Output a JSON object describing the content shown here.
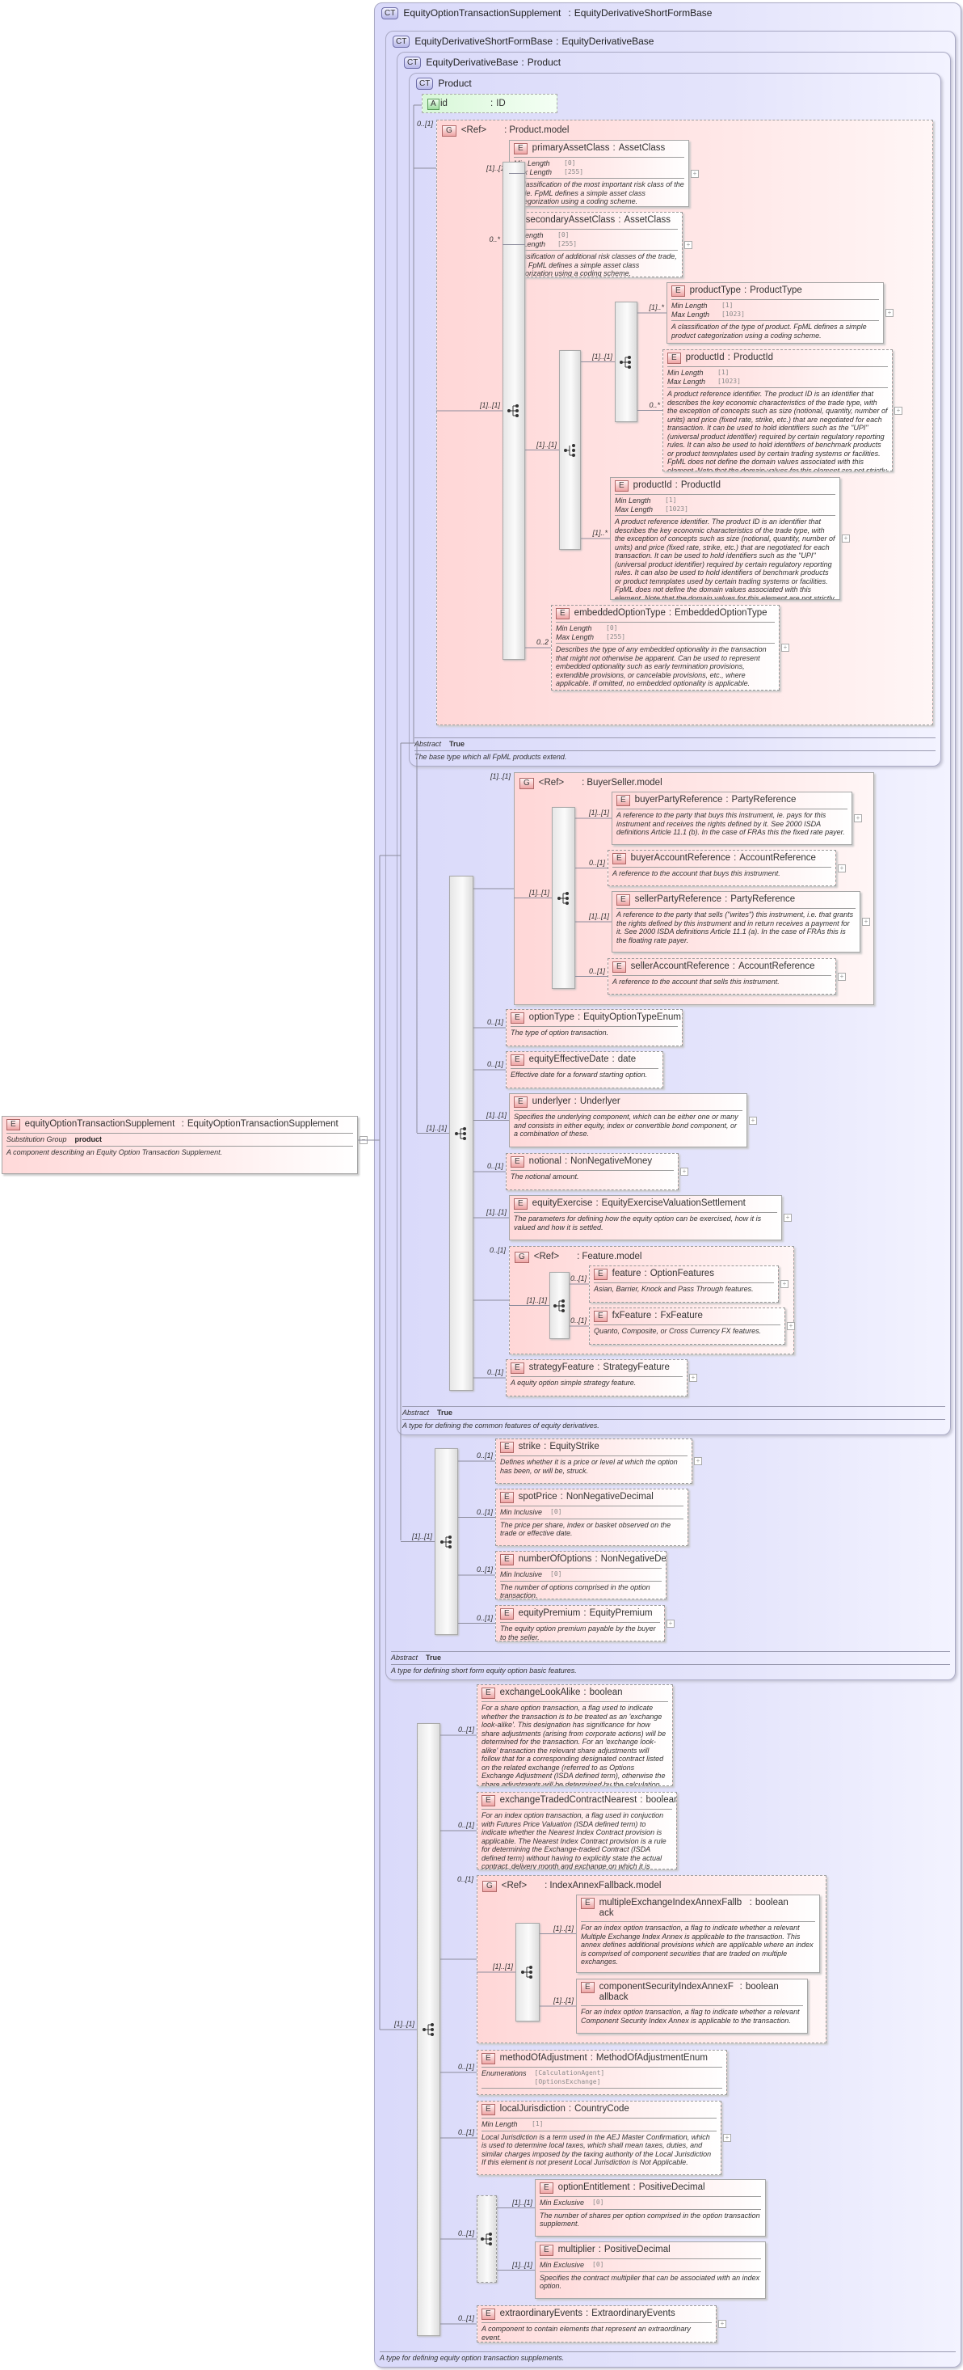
{
  "root": {
    "badge": "E",
    "name": "equityOptionTransactionSupplement",
    "type": "EquityOptionTransactionSupplement",
    "substitution_label": "Substitution Group",
    "substitution_value": "product",
    "doc": "A component describing an Equity Option Transaction Supplement.",
    "expand_icon": "−"
  },
  "complex_types": {
    "ct0": {
      "badge": "CT",
      "name": "EquityOptionTransactionSupplement",
      "base": "EquityDerivativeShortFormBase",
      "doc": "A type for defining equity option transaction supplements."
    },
    "ct1": {
      "badge": "CT",
      "name": "EquityDerivativeShortFormBase",
      "base": "EquityDerivativeBase",
      "abstract_label": "Abstract",
      "abstract_value": "True",
      "doc": "A type for defining short form equity option basic features."
    },
    "ct2": {
      "badge": "CT",
      "name": "EquityDerivativeBase",
      "base": "Product",
      "abstract_label": "Abstract",
      "abstract_value": "True",
      "doc": "A type for defining the common features of equity derivatives."
    },
    "ct3": {
      "badge": "CT",
      "name": "Product",
      "abstract_label": "Abstract",
      "abstract_value": "True",
      "doc": "The base type which all FpML products extend."
    }
  },
  "attribute": {
    "badge": "A",
    "name": "id",
    "type": "ID"
  },
  "groups": {
    "g1": {
      "badge": "G",
      "ref": "<Ref>",
      "name": "Product.model",
      "cardinality": "0..[1]"
    },
    "g2": {
      "badge": "G",
      "ref": "<Ref>",
      "name": "BuyerSeller.model",
      "cardinality": "[1]..[1]"
    },
    "g3": {
      "badge": "G",
      "ref": "<Ref>",
      "name": "Feature.model",
      "cardinality": "0..[1]"
    },
    "g4": {
      "badge": "G",
      "ref": "<Ref>",
      "name": "IndexAnnexFallback.model",
      "cardinality": "0..[1]"
    }
  },
  "compositors": {
    "A": {
      "kind": "sequence",
      "cardinality": "[1]..[1]"
    },
    "B": {
      "kind": "choice",
      "cardinality": "[1]..[1]"
    },
    "C": {
      "kind": "sequence",
      "cardinality": "[1]..[1]"
    },
    "D": {
      "kind": "sequence",
      "cardinality": "[1]..[1]"
    },
    "E": {
      "kind": "sequence",
      "cardinality": "[1]..[1]"
    },
    "F": {
      "kind": "sequence",
      "cardinality": "[1]..[1]"
    },
    "G": {
      "kind": "sequence",
      "cardinality": "[1]..[1]"
    },
    "H": {
      "kind": "sequence",
      "cardinality": "[1]..[1]"
    },
    "I": {
      "kind": "sequence",
      "cardinality": "[1]..[1]"
    },
    "J": {
      "kind": "sequence",
      "cardinality": "0..[1]"
    }
  },
  "elements": {
    "primaryAssetClass": {
      "name": "primaryAssetClass",
      "type": "AssetClass",
      "cardinality": "[1]..[1]",
      "facets": [
        {
          "label": "Min Length",
          "value": "[0]"
        },
        {
          "label": "Max Length",
          "value": "[255]"
        }
      ],
      "doc": "A classification of the most important risk class of the trade. FpML defines a simple asset class categorization using a coding scheme.",
      "expandable": true
    },
    "secondaryAssetClass": {
      "name": "secondaryAssetClass",
      "type": "AssetClass",
      "cardinality": "0..*",
      "facets": [
        {
          "label": "Min Length",
          "value": "[0]"
        },
        {
          "label": "Max Length",
          "value": "[255]"
        }
      ],
      "doc": "A classification of additional risk classes of the trade, if any. FpML defines a simple asset class categorization using a coding scheme.",
      "expandable": true
    },
    "productType": {
      "name": "productType",
      "type": "ProductType",
      "cardinality": "[1]..*",
      "facets": [
        {
          "label": "Min Length",
          "value": "[1]"
        },
        {
          "label": "Max Length",
          "value": "[1023]"
        }
      ],
      "doc": "A classification of the type of product. FpML defines a simple product categorization using a coding scheme.",
      "expandable": true
    },
    "productId1": {
      "name": "productId",
      "type": "ProductId",
      "cardinality": "0..*",
      "facets": [
        {
          "label": "Min Length",
          "value": "[1]"
        },
        {
          "label": "Max Length",
          "value": "[1023]"
        }
      ],
      "doc": "A product reference identifier. The product ID is an identifier that describes the key economic characteristics of the trade type, with the exception of concepts such as size (notional, quantity, number of units) and price (fixed rate, strike, etc.) that are negotiated for each transaction. It can be used to hold identifiers such as the \"UPI\" (universal product identifier) required by certain regulatory reporting rules. It can also be used to hold identifiers of benchmark products or product temnplates used by certain trading systems or facilities. FpML does not define the domain values associated with this element. Note that the domain values for this element are not strictly an enumerated list.",
      "expandable": true
    },
    "productId2": {
      "name": "productId",
      "type": "ProductId",
      "cardinality": "[1]..*",
      "facets": [
        {
          "label": "Min Length",
          "value": "[1]"
        },
        {
          "label": "Max Length",
          "value": "[1023]"
        }
      ],
      "doc": "A product reference identifier. The product ID is an identifier that describes the key economic characteristics of the trade type, with the exception of concepts such as size (notional, quantity, number of units) and price (fixed rate, strike, etc.) that are negotiated for each transaction. It can be used to hold identifiers such as the \"UPI\" (universal product identifier) required by certain regulatory reporting rules. It can also be used to hold identifiers of benchmark products or product temnplates used by certain trading systems or facilities. FpML does not define the domain values associated with this element. Note that the domain values for this element are not strictly an enumerated list.",
      "expandable": true
    },
    "embeddedOptionType": {
      "name": "embeddedOptionType",
      "type": "EmbeddedOptionType",
      "cardinality": "0..2",
      "facets": [
        {
          "label": "Min Length",
          "value": "[0]"
        },
        {
          "label": "Max Length",
          "value": "[255]"
        }
      ],
      "doc": "Describes the type of any embedded optionality in the transaction that might not otherwise be apparent. Can be used to represent embedded optionality such as early termination provisions, extendible provisions, or cancelable provisions, etc., where applicable. If omitted, no embedded optionality is applicable.",
      "expandable": true
    },
    "buyerPartyReference": {
      "name": "buyerPartyReference",
      "type": "PartyReference",
      "cardinality": "[1]..[1]",
      "facets": [],
      "doc": "A reference to the party that buys this instrument, ie. pays for this instrument and receives the rights defined by it. See 2000 ISDA definitions Article 11.1 (b). In the case of FRAs this the fixed rate payer.",
      "expandable": true
    },
    "buyerAccountReference": {
      "name": "buyerAccountReference",
      "type": "AccountReference",
      "cardinality": "0..[1]",
      "facets": [],
      "doc": "A reference to the account that buys this instrument.",
      "expandable": true
    },
    "sellerPartyReference": {
      "name": "sellerPartyReference",
      "type": "PartyReference",
      "cardinality": "[1]..[1]",
      "facets": [],
      "doc": "A reference to the party that sells (\"writes\") this instrument, i.e. that grants the rights defined by this instrument and in return receives a payment for it. See 2000 ISDA definitions Article 11.1 (a). In the case of FRAs this is the floating rate payer.",
      "expandable": true
    },
    "sellerAccountReference": {
      "name": "sellerAccountReference",
      "type": "AccountReference",
      "cardinality": "0..[1]",
      "facets": [],
      "doc": "A reference to the account that sells this instrument.",
      "expandable": true
    },
    "optionType": {
      "name": "optionType",
      "type": "EquityOptionTypeEnum",
      "cardinality": "0..[1]",
      "facets": [],
      "doc": "The type of option transaction.",
      "expandable": false
    },
    "equityEffectiveDate": {
      "name": "equityEffectiveDate",
      "type": "date",
      "cardinality": "0..[1]",
      "facets": [],
      "doc": "Effective date for a forward starting option.",
      "expandable": false
    },
    "underlyer": {
      "name": "underlyer",
      "type": "Underlyer",
      "cardinality": "[1]..[1]",
      "facets": [],
      "doc": "Specifies the underlying component, which can be either one or many and consists in either equity, index or convertible bond component, or a combination of these.",
      "expandable": true
    },
    "notional": {
      "name": "notional",
      "type": "NonNegativeMoney",
      "cardinality": "0..[1]",
      "facets": [],
      "doc": "The notional amount.",
      "expandable": true
    },
    "equityExercise": {
      "name": "equityExercise",
      "type": "EquityExerciseValuationSettlement",
      "cardinality": "[1]..[1]",
      "facets": [],
      "doc": "The parameters for defining how the equity option can be exercised, how it is valued and how it is settled.",
      "expandable": true
    },
    "feature": {
      "name": "feature",
      "type": "OptionFeatures",
      "cardinality": "0..[1]",
      "facets": [],
      "doc": "Asian, Barrier, Knock and Pass Through features.",
      "expandable": true
    },
    "fxFeature": {
      "name": "fxFeature",
      "type": "FxFeature",
      "cardinality": "0..[1]",
      "facets": [],
      "doc": "Quanto, Composite, or Cross Currency FX features.",
      "expandable": true
    },
    "strategyFeature": {
      "name": "strategyFeature",
      "type": "StrategyFeature",
      "cardinality": "0..[1]",
      "facets": [],
      "doc": "A equity option simple strategy feature.",
      "expandable": true
    },
    "strike": {
      "name": "strike",
      "type": "EquityStrike",
      "cardinality": "0..[1]",
      "facets": [],
      "doc": "Defines whether it is a price or level at which the option has been, or will be, struck.",
      "expandable": true
    },
    "spotPrice": {
      "name": "spotPrice",
      "type": "NonNegativeDecimal",
      "cardinality": "0..[1]",
      "facets": [
        {
          "label": "Min Inclusive",
          "value": "[0]"
        }
      ],
      "doc": "The price per share, index or basket observed on the trade or effective date.",
      "expandable": false
    },
    "numberOfOptions": {
      "name": "numberOfOptions",
      "type": "NonNegativeDecimal",
      "cardinality": "0..[1]",
      "facets": [
        {
          "label": "Min Inclusive",
          "value": "[0]"
        }
      ],
      "doc": "The number of options comprised in the option transaction.",
      "expandable": false
    },
    "equityPremium": {
      "name": "equityPremium",
      "type": "EquityPremium",
      "cardinality": "0..[1]",
      "facets": [],
      "doc": "The equity option premium payable by the buyer to the seller.",
      "expandable": true
    },
    "exchangeLookAlike": {
      "name": "exchangeLookAlike",
      "type": "boolean",
      "cardinality": "0..[1]",
      "facets": [],
      "doc": "For a share option transaction, a flag used to indicate whether the transaction is to be treated as an 'exchange look-alike'. This designation has significance for how share adjustments (arising from corporate actions) will be determined for the transaction. For an 'exchange look-alike' transaction the relevant share adjustments will follow that for a corresponding designated contract listed on the related exchange (referred to as Options Exchange Adjustment (ISDA defined term), otherwise the share adjustments will be determined by the calculation agent (referred to as Calculation Agent Adjustment (ISDA defined term)).",
      "expandable": false
    },
    "exchangeTradedContractNearest": {
      "name": "exchangeTradedContractNearest",
      "type": "boolean",
      "cardinality": "0..[1]",
      "facets": [],
      "doc": "For an index option transaction, a flag used in conjuction with Futures Price Valuation (ISDA defined term) to indicate whether the Nearest Index Contract provision is applicable. The Nearest Index Contract provision is a rule for determining the Exchange-traded Contract (ISDA defined term) without having to explicitly state the actual contract, delivery month and exchange on which it is traded.",
      "expandable": false
    },
    "multipleExchangeIndexAnnexFallback": {
      "name": "multipleExchangeIndexAnnexFallback",
      "type": "boolean",
      "cardinality": "[1]..[1]",
      "facets": [],
      "doc": "For an index option transaction, a flag to indicate whether a relevant Multiple Exchange Index Annex is applicable to the transaction. This annex defines additional provisions which are applicable where an index is comprised of component securities that are traded on multiple exchanges.",
      "expandable": false
    },
    "componentSecurityIndexAnnexFallback": {
      "name": "componentSecurityIndexAnnexFallback",
      "type": "boolean",
      "cardinality": "[1]..[1]",
      "facets": [],
      "doc": "For an index option transaction, a flag to indicate whether a relevant Component Security Index Annex is applicable to the transaction.",
      "expandable": false
    },
    "methodOfAdjustment": {
      "name": "methodOfAdjustment",
      "type": "MethodOfAdjustmentEnum",
      "cardinality": "0..[1]",
      "facets": [
        {
          "label": "Enumerations",
          "value": "[CalculationAgent]\n[OptionsExchange]"
        }
      ],
      "doc": "",
      "expandable": false
    },
    "localJurisdiction": {
      "name": "localJurisdiction",
      "type": "CountryCode",
      "cardinality": "0..[1]",
      "facets": [
        {
          "label": "Min Length",
          "value": "[1]"
        }
      ],
      "doc": "Local Jurisdiction is a term used in the AEJ Master Confirmation, which is used to determine local taxes, which shall mean taxes, duties, and similar charges imposed by the taxing authority of the Local Jurisdiction If this element is not present Local Jurisdiction is Not Applicable.",
      "expandable": true
    },
    "optionEntitlement": {
      "name": "optionEntitlement",
      "type": "PositiveDecimal",
      "cardinality": "[1]..[1]",
      "facets": [
        {
          "label": "Min Exclusive",
          "value": "[0]"
        }
      ],
      "doc": "The number of shares per option comprised in the option transaction supplement.",
      "expandable": false
    },
    "multiplier": {
      "name": "multiplier",
      "type": "PositiveDecimal",
      "cardinality": "[1]..[1]",
      "facets": [
        {
          "label": "Min Exclusive",
          "value": "[0]"
        }
      ],
      "doc": "Specifies the contract multiplier that can be associated with an index option.",
      "expandable": false
    },
    "extraordinaryEvents": {
      "name": "extraordinaryEvents",
      "type": "ExtraordinaryEvents",
      "cardinality": "0..[1]",
      "facets": [],
      "doc": "A component to contain elements that represent an extraordinary event.",
      "expandable": true
    }
  }
}
